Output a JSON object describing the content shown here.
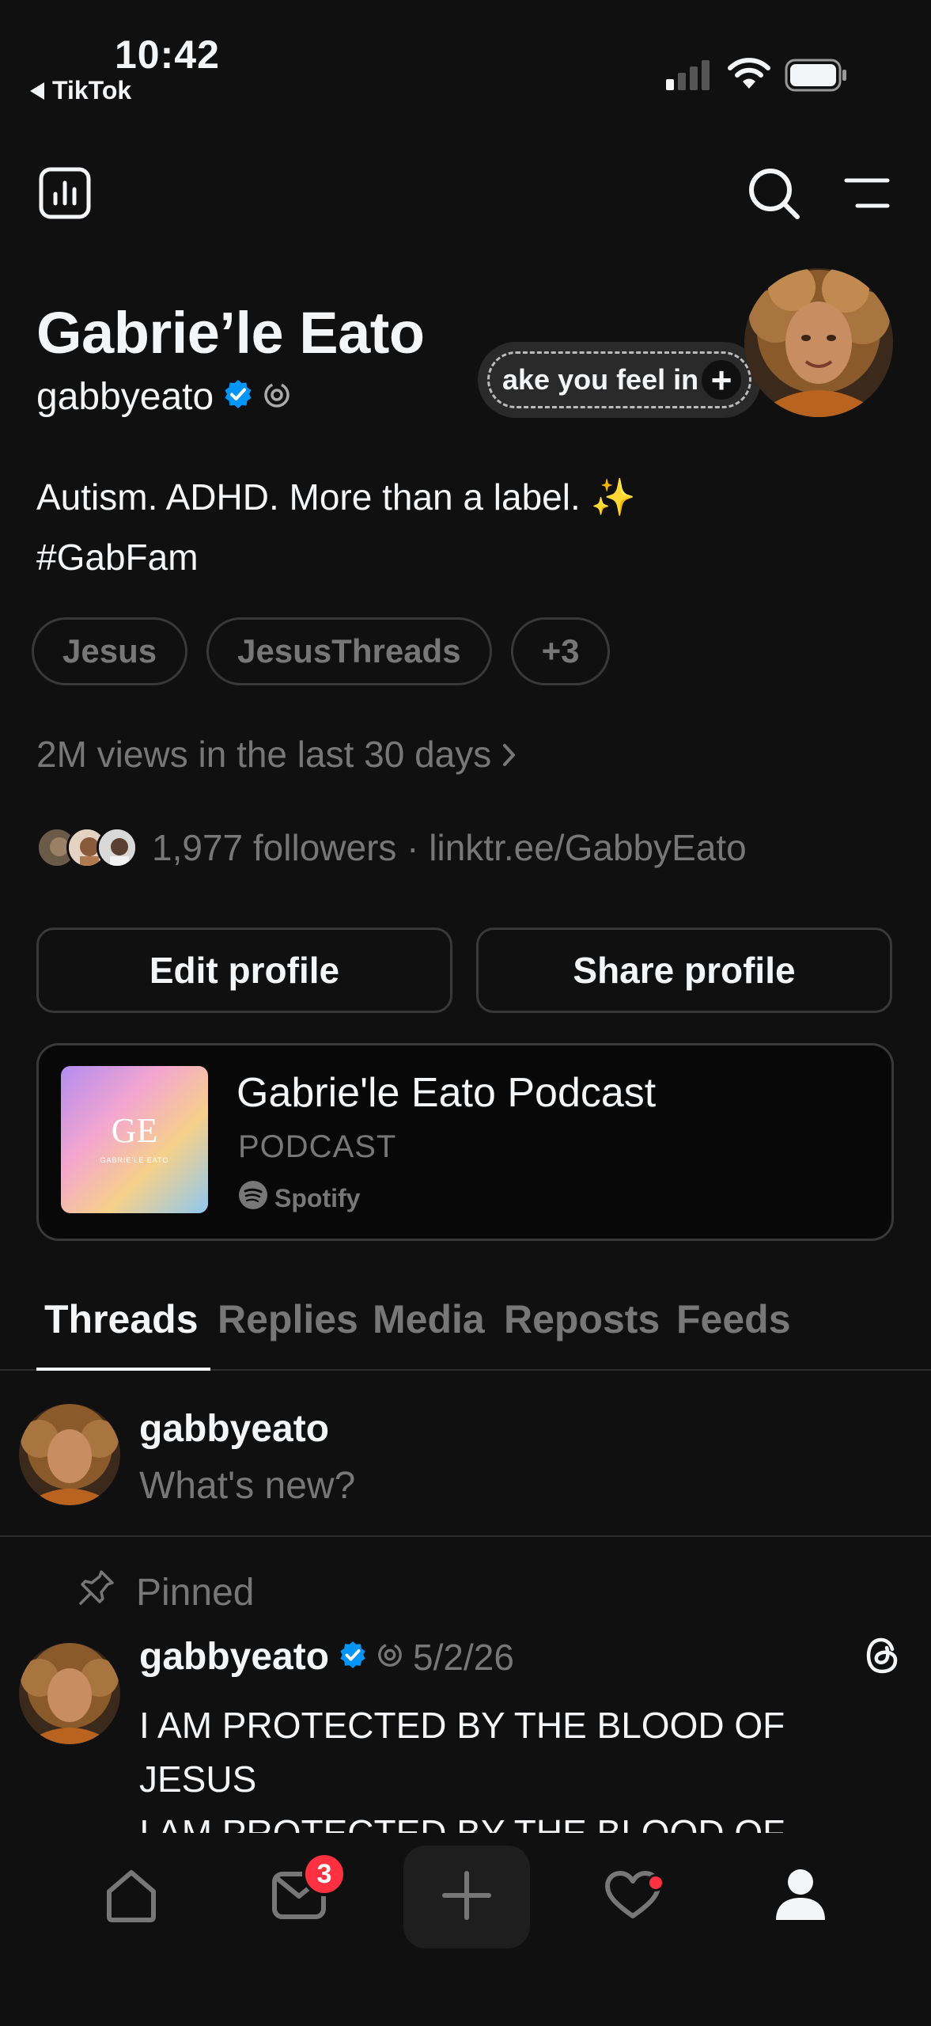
{
  "status_bar": {
    "time": "10:42",
    "back_app": "TikTok"
  },
  "profile": {
    "display_name": "Gabrie’le Eato",
    "username": "gabbyeato",
    "note_text": "ake you feel in",
    "bio_line1": "Autism. ADHD. More than a label. ✨",
    "bio_line2": "#GabFam",
    "interests": [
      "Jesus",
      "JesusThreads",
      "+3"
    ],
    "views_text": "2M views in the last 30 days",
    "followers_text": "1,977 followers · linktr.ee/GabbyEato"
  },
  "actions": {
    "edit_label": "Edit profile",
    "share_label": "Share profile"
  },
  "podcast": {
    "title": "Gabrie'le Eato Podcast",
    "subtitle": "PODCAST",
    "provider": "Spotify",
    "art_monogram": "GE",
    "art_caption": "GABRIE'LE EATO"
  },
  "tabs": [
    "Threads",
    "Replies",
    "Media",
    "Reposts",
    "Feeds"
  ],
  "compose": {
    "username": "gabbyeato",
    "placeholder": "What's new?"
  },
  "pinned_label": "Pinned",
  "post": {
    "username": "gabbyeato",
    "date": "5/2/26",
    "line1": "I AM PROTECTED BY THE BLOOD OF",
    "line2": "JESUS",
    "line3": "I AM PROTECTED BY THE BLOOD OF"
  },
  "nav": {
    "inbox_badge": "3"
  },
  "colors": {
    "background": "#101010",
    "verified": "#0095f6",
    "badge": "#ff3040",
    "muted": "#777777"
  }
}
